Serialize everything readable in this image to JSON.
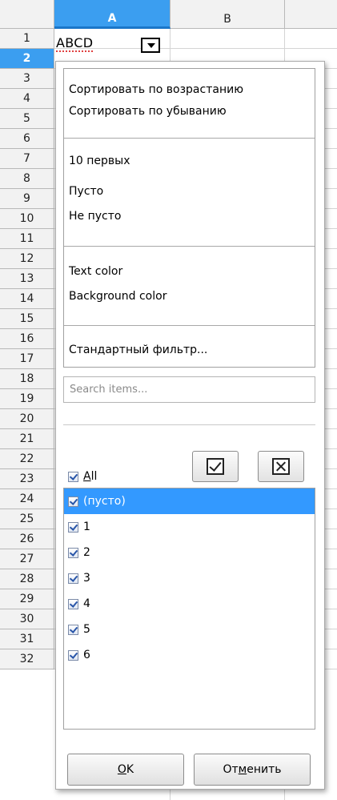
{
  "columns": [
    {
      "label": "A",
      "selected": true
    },
    {
      "label": "B",
      "selected": false
    }
  ],
  "rows": [
    "1",
    "2",
    "3",
    "4",
    "5",
    "6",
    "7",
    "8",
    "9",
    "10",
    "11",
    "12",
    "13",
    "14",
    "15",
    "16",
    "17",
    "18",
    "19",
    "20",
    "21",
    "22",
    "23",
    "24",
    "25",
    "26",
    "27",
    "28",
    "29",
    "30",
    "31",
    "32"
  ],
  "selected_row": "2",
  "cell_a1": "ABCD",
  "menu": {
    "sort_asc": "Сортировать по возрастанию",
    "sort_desc": "Сортировать по убыванию",
    "top10": "10 первых",
    "empty": "Пусто",
    "not_empty": "Не пусто",
    "text_color": "Text color",
    "background_color": "Background color",
    "standard_filter": "Стандартный фильтр..."
  },
  "search": {
    "placeholder": "Search items..."
  },
  "all_label_prefix": "",
  "all_label_underline": "A",
  "all_label_rest": "ll",
  "items": [
    {
      "label": "(пусто)",
      "checked": true,
      "selected": true
    },
    {
      "label": "1",
      "checked": true,
      "selected": false
    },
    {
      "label": "2",
      "checked": true,
      "selected": false
    },
    {
      "label": "3",
      "checked": true,
      "selected": false
    },
    {
      "label": "4",
      "checked": true,
      "selected": false
    },
    {
      "label": "5",
      "checked": true,
      "selected": false
    },
    {
      "label": "6",
      "checked": true,
      "selected": false
    }
  ],
  "buttons": {
    "ok_underline": "O",
    "ok_rest": "K",
    "cancel_prefix": "От",
    "cancel_underline": "м",
    "cancel_rest": "енить"
  },
  "colors": {
    "selection": "#3399ff",
    "header_selected": "#3b9ef0"
  }
}
